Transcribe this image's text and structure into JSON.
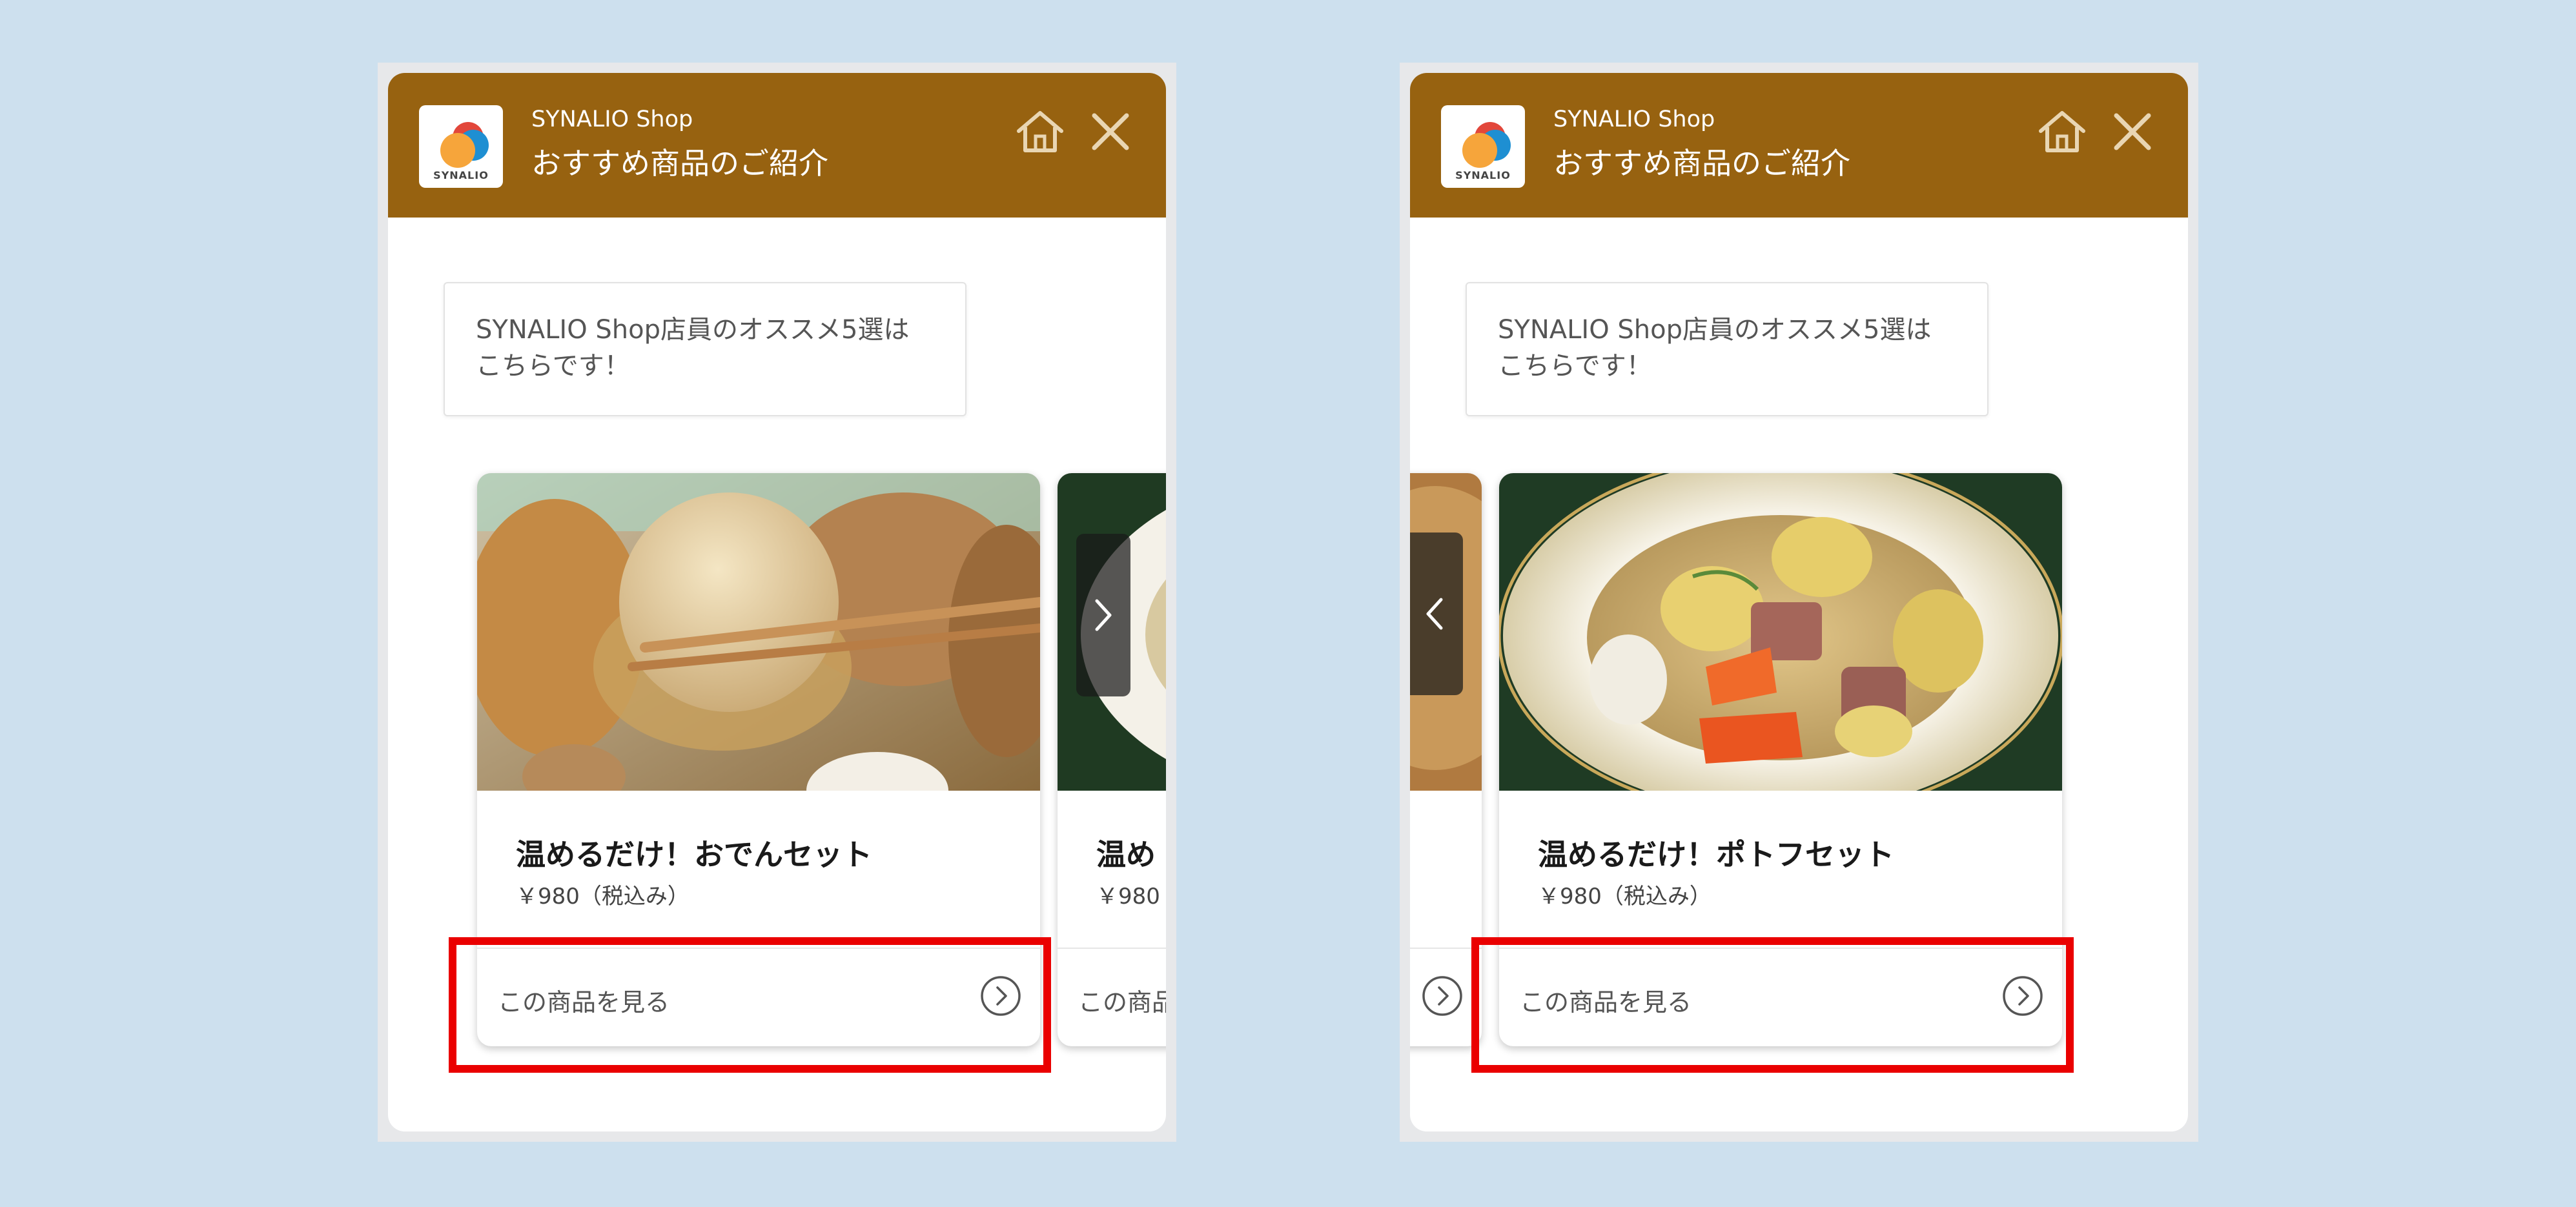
{
  "widget_left": {
    "header": {
      "shop_name": "SYNALIO Shop",
      "title": "おすすめ商品のご紹介",
      "logo_text": "SYNALIO"
    },
    "message": "SYNALIO Shop店員のオススメ5選はこちらです！",
    "cards": [
      {
        "name": "温めるだけ！おでんセット",
        "price": "￥980（税込み）",
        "link_label": "この商品を見る",
        "image": "oden-photo"
      },
      {
        "name": "温め",
        "price": "￥980",
        "link_label": "この商品",
        "image": "pot-au-feu-photo"
      }
    ],
    "nav_button": "chevron-right-icon"
  },
  "widget_right": {
    "header": {
      "shop_name": "SYNALIO Shop",
      "title": "おすすめ商品のご紹介",
      "logo_text": "SYNALIO"
    },
    "message": "SYNALIO Shop店員のオススメ5選はこちらです！",
    "cards": [
      {
        "name": "温めるだけ！ポトフセット",
        "price": "￥980（税込み）",
        "link_label": "この商品を見る",
        "image": "pot-au-feu-photo"
      }
    ],
    "nav_button": "chevron-left-icon"
  },
  "colors": {
    "background": "#cde0ee",
    "header": "#976210",
    "highlight": "#ea0000"
  }
}
